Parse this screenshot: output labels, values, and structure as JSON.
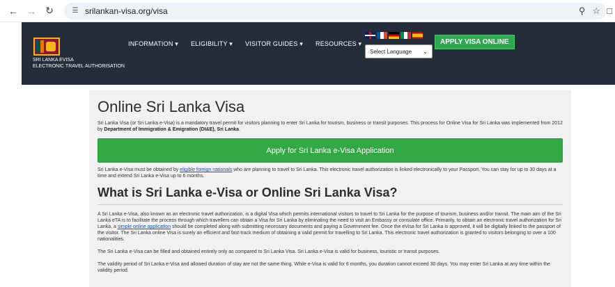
{
  "browser": {
    "url": "srilankan-visa.org/visa"
  },
  "header": {
    "logo_line1": "SRI LANKA EVISA",
    "logo_line2": "ELECTRONIC TRAVEL AUTHORISATION",
    "nav": [
      "INFORMATION",
      "ELIGIBILITY",
      "VISITOR GUIDES",
      "RESOURCES"
    ],
    "language_select": "Select Language",
    "apply_button": "APPLY VISA ONLINE",
    "flags": [
      "uk-flag",
      "france-flag",
      "germany-flag",
      "italy-flag",
      "spain-flag"
    ]
  },
  "main": {
    "title": "Online Sri Lanka Visa",
    "intro_text": "Sri Lanka Visa (or Sri Lanka e-Visa) is a mandatory travel permit for visitors planning to enter Sri Lanka for tourism, business or transit purposes. This process for Online Visa for Sri Lanka was implemented from 2012 by ",
    "intro_bold": "Department of Immigration & Emigration (DI&E), Sri Lanka",
    "intro_end": ".",
    "apply_bar": "Apply for Sri Lanka e-Visa Application",
    "p1_before": "Sri Lanka e-Visa must be obtained by ",
    "p1_link": "eligible foreign nationals",
    "p1_after": " who are planning to travel to Sri Lanka. This electronic travel authorization is linked electronically to your Passport. You can stay for up to 30 days at a time and extend Sri Lanka e-Visa up to 6 months.",
    "heading2": "What is Sri Lanka e-Visa or Online Sri Lanka Visa?",
    "p2_before": "A Sri Lanka e-Visa, also known as an electronic travel authorization, is a digital Visa which permits international visitors to travel to Sri Lanka for the purpose of tourism, business and/or transit. The main aim of the Sri Lanka eTA is to facilitate the process through which travellers can obtain a Visa for Sri Lanka by eliminating the need to visit an Embassy or consulate office. Primarily, to obtain an electronic travel authorization for Sri Lanka, a ",
    "p2_link": "simple online application",
    "p2_after": " should be completed along with submitting necessary documents and paying a Government fee. Once the eVisa for Sri Lanka is approved, it will be digitally linked to the passport of the visitor. The Sri Lanka online Visa is surely an efficient and fast-track medium of obtaining a valid permit for travelling to Sri Lanka. This electronic travel authorization is granted to visitors belonging to over a 100 nationalities.",
    "p3": "The Sri Lanka e-Visa can be filled and obtained entirely only as compared to Sri Lanka Visa. Sri Lanka e-Visa is valid for business, touristic or transit purposes.",
    "p4": "The validity period of Sri Lanka e-Visa and allowed duration of stay are not the same thing. While e-Visa is valid for 6 months, you duration cannot exceed 30 days. You may enter Sri Lanka at any time within the validity period."
  }
}
